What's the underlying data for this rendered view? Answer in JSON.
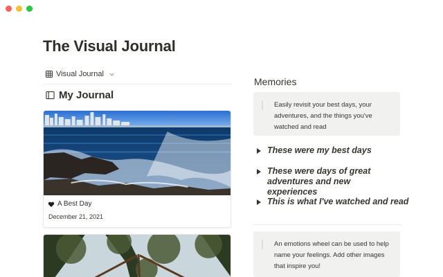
{
  "window": {
    "controls": [
      "close",
      "minimize",
      "zoom"
    ]
  },
  "page": {
    "title": "The Visual Journal"
  },
  "view": {
    "label": "Visual Journal",
    "icon": "table-grid-icon"
  },
  "journal": {
    "title": "My Journal",
    "icon": "book-icon",
    "cards": [
      {
        "title": "A Best Day",
        "icon": "black-heart-icon",
        "date": "December 21, 2021",
        "cover": "ocean-waves-city-skyline"
      },
      {
        "title": "",
        "cover": "pine-trees-looking-up"
      }
    ]
  },
  "memories": {
    "title": "Memories",
    "callout_top": "Easily revisit your best days, your adventures, and the things you've watched and read",
    "toggles": [
      "These were my best days",
      "These were days of great adventures and new experiences",
      "This is what I've watched and read"
    ],
    "callout_bottom": "An emotions wheel can be used to help name your feelings. Add other images that inspire you!"
  }
}
